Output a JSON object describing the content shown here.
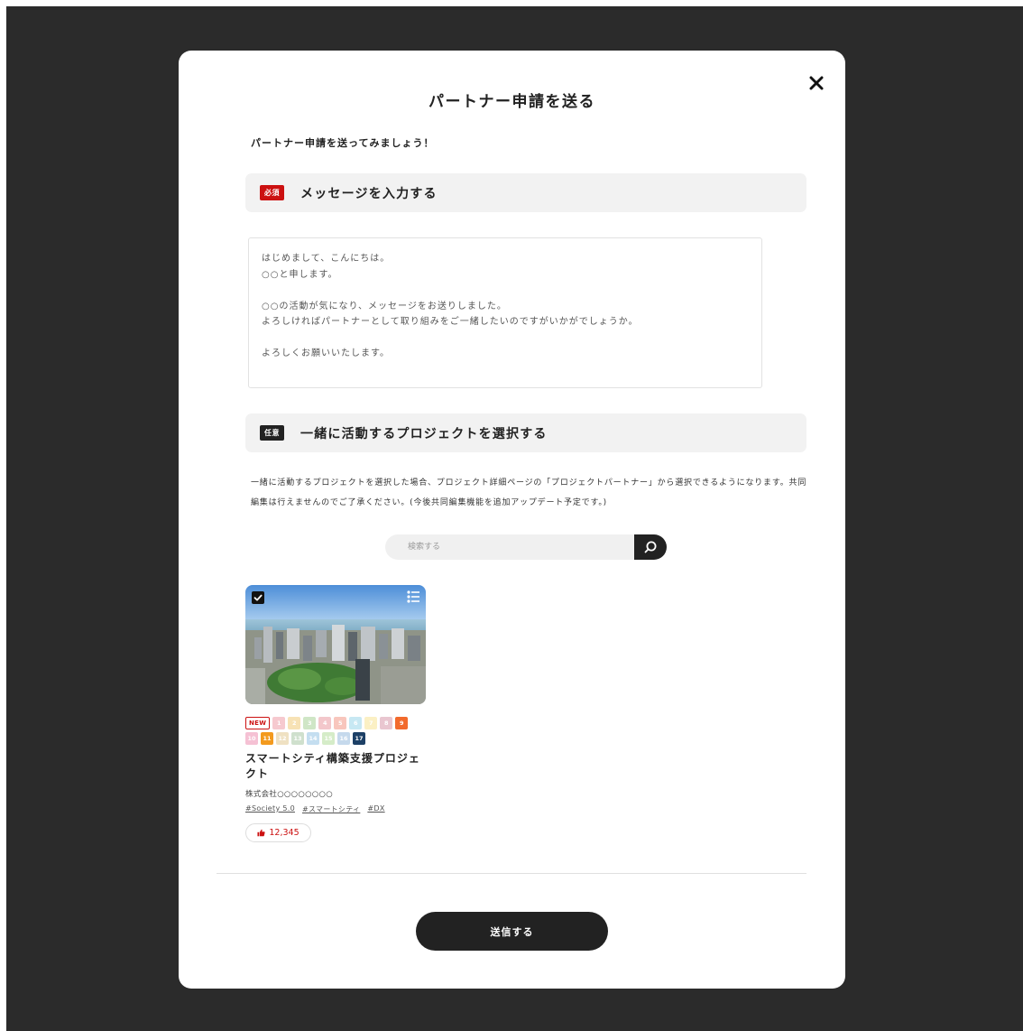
{
  "modal": {
    "title": "パートナー申請を送る",
    "intro": "パートナー申請を送ってみましょう！"
  },
  "section_message": {
    "badge": "必須",
    "title": "メッセージを入力する",
    "lines": [
      "はじめまして、こんにちは。",
      "○○と申します。",
      "",
      "○○の活動が気になり、メッセージをお送りしました。",
      "よろしければパートナーとして取り組みをご一緒したいのですがいかがでしょうか。",
      "",
      "よろしくお願いいたします。"
    ]
  },
  "section_project": {
    "badge": "任意",
    "title": "一緒に活動するプロジェクトを選択する",
    "description": "一緒に活動するプロジェクトを選択した場合、プロジェクト詳細ページの「プロジェクトパートナー」から選択できるようになります。共同編集は行えませんのでご了承ください。(今後共同編集機能を追加アップデート予定です。)"
  },
  "search": {
    "placeholder": "検索する",
    "icon": "search-icon"
  },
  "project_card": {
    "checked": true,
    "new_label": "NEW",
    "goals_row1": [
      {
        "n": "1",
        "color": "#f6c9cf"
      },
      {
        "n": "2",
        "color": "#f7e2b5"
      },
      {
        "n": "3",
        "color": "#cfe6c6"
      },
      {
        "n": "4",
        "color": "#f3c7cb"
      },
      {
        "n": "5",
        "color": "#f8c6bd"
      },
      {
        "n": "6",
        "color": "#c7e8f3"
      },
      {
        "n": "7",
        "color": "#fbf0c4"
      },
      {
        "n": "8",
        "color": "#e9c6d0"
      },
      {
        "n": "9",
        "color": "#f26a2c"
      }
    ],
    "goals_row2": [
      {
        "n": "10",
        "color": "#f5c1d4"
      },
      {
        "n": "11",
        "color": "#f39a1e"
      },
      {
        "n": "12",
        "color": "#efe1c2"
      },
      {
        "n": "13",
        "color": "#cfe0cd"
      },
      {
        "n": "14",
        "color": "#c4def0"
      },
      {
        "n": "15",
        "color": "#d5ecc8"
      },
      {
        "n": "16",
        "color": "#c5d9ec"
      },
      {
        "n": "17",
        "color": "#1d4066"
      }
    ],
    "title": "スマートシティ構築支援プロジェクト",
    "company": "株式会社○○○○○○○○",
    "tags": [
      "#Society 5.0",
      "#スマートシティ",
      "#DX"
    ],
    "likes": "12,345"
  },
  "footer": {
    "submit_label": "送信する"
  },
  "colors": {
    "required_badge": "#cc1111",
    "optional_badge": "#222222",
    "overlay": "#2b2b2b"
  }
}
